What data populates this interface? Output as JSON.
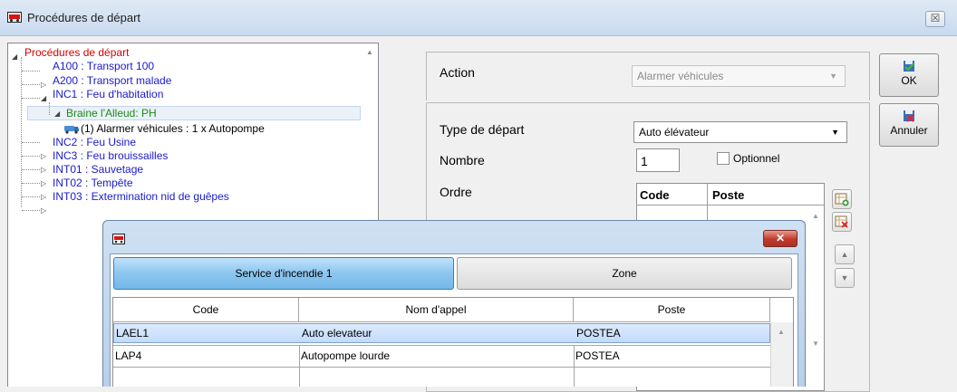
{
  "window": {
    "title": "Procédures de départ",
    "close_glyph": "☒"
  },
  "tree": {
    "nodes": [
      {
        "label": "Procédures de départ",
        "color": "#d40000"
      },
      {
        "label": "A100 : Transport 100",
        "color": "#1a1acc"
      },
      {
        "label": "A200 : Transport malade",
        "color": "#1a1acc"
      },
      {
        "label": "INC1 : Feu d'habitation",
        "color": "#1a1acc"
      },
      {
        "label": "Braine l'Alleud: PH",
        "color": "#1d8a1d"
      },
      {
        "label": "(1) Alarmer véhicules : 1 x Autopompe",
        "color": "#000000"
      },
      {
        "label": "INC2 : Feu  Usine",
        "color": "#1a1acc"
      },
      {
        "label": "INC3 : Feu brouissailles",
        "color": "#1a1acc"
      },
      {
        "label": "INT01 : Sauvetage",
        "color": "#1a1acc"
      },
      {
        "label": "INT02 : Tempête",
        "color": "#1a1acc"
      },
      {
        "label": "INT03 : Extermination nid de guêpes",
        "color": "#1a1acc"
      }
    ]
  },
  "form": {
    "action_label": "Action",
    "action_value": "Alarmer véhicules",
    "type_label": "Type de départ",
    "type_value": "Auto élévateur",
    "nombre_label": "Nombre",
    "nombre_value": "1",
    "optional_label": "Optionnel",
    "ordre_label": "Ordre",
    "ordre_columns": [
      "Code",
      "Poste"
    ]
  },
  "buttons": {
    "ok_label": "OK",
    "cancel_label": "Annuler"
  },
  "dialog": {
    "close_glyph": "✕",
    "tabs": [
      {
        "label": "Service d'incendie 1",
        "active": true
      },
      {
        "label": "Zone",
        "active": false
      }
    ],
    "columns": [
      "Code",
      "Nom d'appel",
      "Poste"
    ],
    "rows": [
      {
        "code": "LAEL1",
        "name": "Auto elevateur",
        "poste": "POSTEA",
        "selected": true
      },
      {
        "code": "LAP4",
        "name": "Autopompe lourde",
        "poste": "POSTEA",
        "selected": false
      }
    ]
  },
  "colors": {
    "titlebar": "#c9daef",
    "tab_active": "#8cc6ef",
    "row_selected": "#c1dbfc"
  }
}
